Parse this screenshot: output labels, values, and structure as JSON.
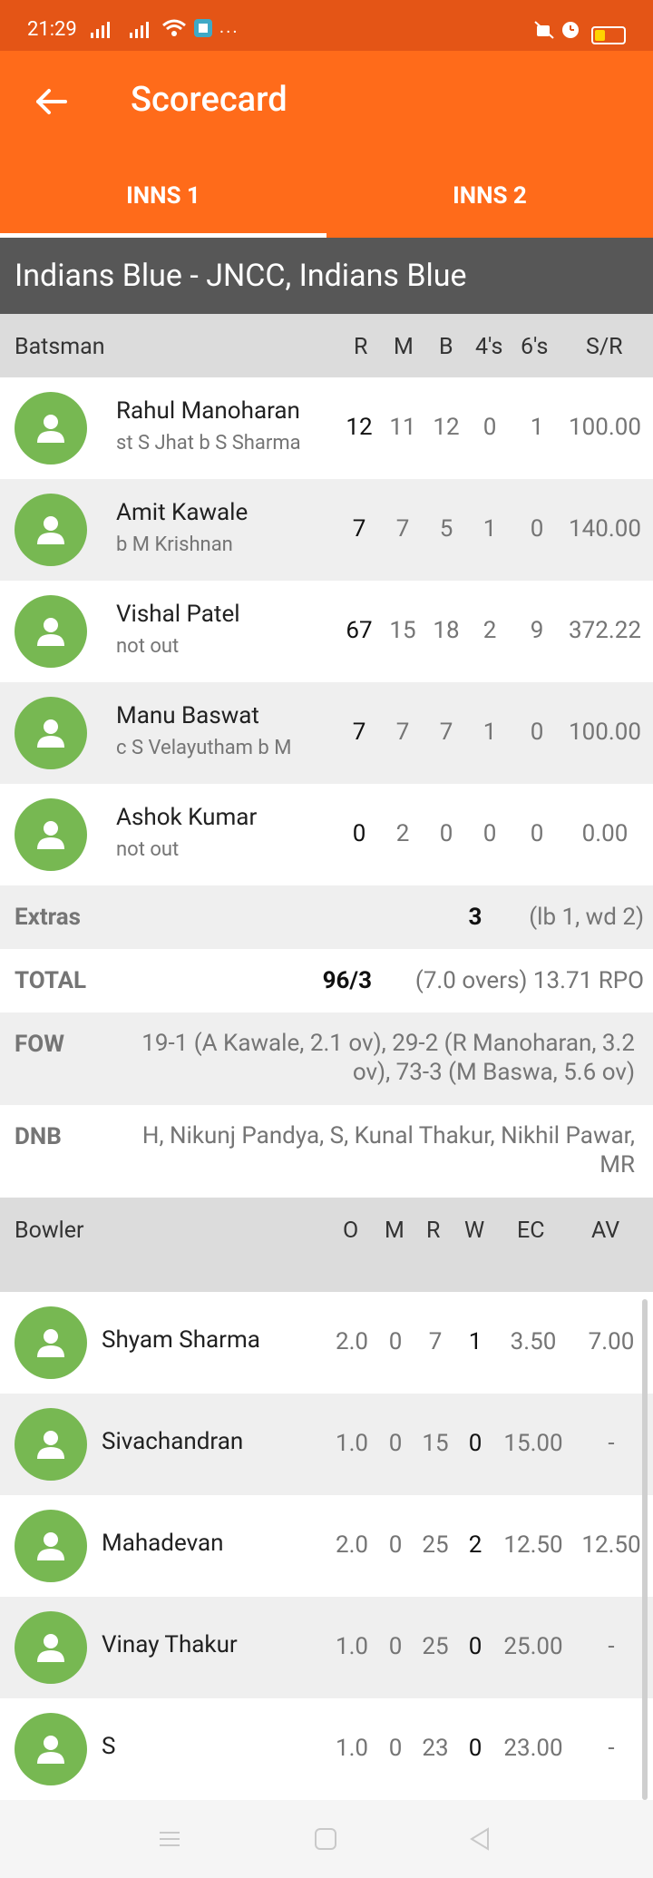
{
  "status": {
    "time": "21:29",
    "icons": [
      "signal-icon",
      "signal-icon",
      "wifi-icon",
      "app-icon",
      "more-icon"
    ],
    "right_icons": [
      "mute-icon",
      "alarm-icon",
      "battery-icon"
    ],
    "battery_level": 0.35,
    "battery_color": "#ffd400"
  },
  "app_bar": {
    "title": "Scorecard",
    "color": "#ff6b1a"
  },
  "tabs": [
    {
      "label": "INNS 1",
      "active": true
    },
    {
      "label": "INNS 2",
      "active": false
    }
  ],
  "team": "Indians Blue - JNCC, Indians Blue",
  "batting": {
    "headers": {
      "name": "Batsman",
      "r": "R",
      "m": "M",
      "b": "B",
      "fours": "4's",
      "sixes": "6's",
      "sr": "S/R"
    },
    "rows": [
      {
        "name": "Rahul Manoharan",
        "desc": "st S Jhat b S Sharma",
        "r": "12",
        "m": "11",
        "b": "12",
        "fours": "0",
        "sixes": "1",
        "sr": "100.00"
      },
      {
        "name": "Amit Kawale",
        "desc": "b M Krishnan",
        "r": "7",
        "m": "7",
        "b": "5",
        "fours": "1",
        "sixes": "0",
        "sr": "140.00"
      },
      {
        "name": "Vishal Patel",
        "desc": "not out",
        "r": "67",
        "m": "15",
        "b": "18",
        "fours": "2",
        "sixes": "9",
        "sr": "372.22"
      },
      {
        "name": "Manu Baswat",
        "desc": "c S Velayutham b M",
        "r": "7",
        "m": "7",
        "b": "7",
        "fours": "1",
        "sixes": "0",
        "sr": "100.00"
      },
      {
        "name": "Ashok Kumar",
        "desc": "not out",
        "r": "0",
        "m": "2",
        "b": "0",
        "fours": "0",
        "sixes": "0",
        "sr": "0.00"
      }
    ]
  },
  "extras": {
    "label": "Extras",
    "value": "3",
    "detail": "(lb 1, wd 2)"
  },
  "total": {
    "label": "TOTAL",
    "value": "96/3",
    "detail": "(7.0 overs) 13.71 RPO"
  },
  "fow": {
    "label": "FOW",
    "line1": "19-1 (A Kawale, 2.1 ov), 29-2 (R Manoharan, 3.2",
    "line2": "ov), 73-3 (M Baswa, 5.6 ov)"
  },
  "dnb": {
    "label": "DNB",
    "line1": "H, Nikunj Pandya, S, Kunal Thakur, Nikhil Pawar,",
    "line2": "MR"
  },
  "bowling": {
    "headers": {
      "name": "Bowler",
      "o": "O",
      "m": "M",
      "r": "R",
      "w": "W",
      "ec": "EC",
      "av": "AV"
    },
    "rows": [
      {
        "name": "Shyam Sharma",
        "o": "2.0",
        "m": "0",
        "r": "7",
        "w": "1",
        "ec": "3.50",
        "av": "7.00"
      },
      {
        "name": "Sivachandran",
        "o": "1.0",
        "m": "0",
        "r": "15",
        "w": "0",
        "ec": "15.00",
        "av": "-"
      },
      {
        "name": "Mahadevan",
        "o": "2.0",
        "m": "0",
        "r": "25",
        "w": "2",
        "ec": "12.50",
        "av": "12.50"
      },
      {
        "name": "Vinay Thakur",
        "o": "1.0",
        "m": "0",
        "r": "25",
        "w": "0",
        "ec": "25.00",
        "av": "-"
      },
      {
        "name": "S",
        "o": "1.0",
        "m": "0",
        "r": "23",
        "w": "0",
        "ec": "23.00",
        "av": "-"
      }
    ]
  },
  "nav": [
    "menu-icon",
    "home-icon",
    "back-icon"
  ]
}
